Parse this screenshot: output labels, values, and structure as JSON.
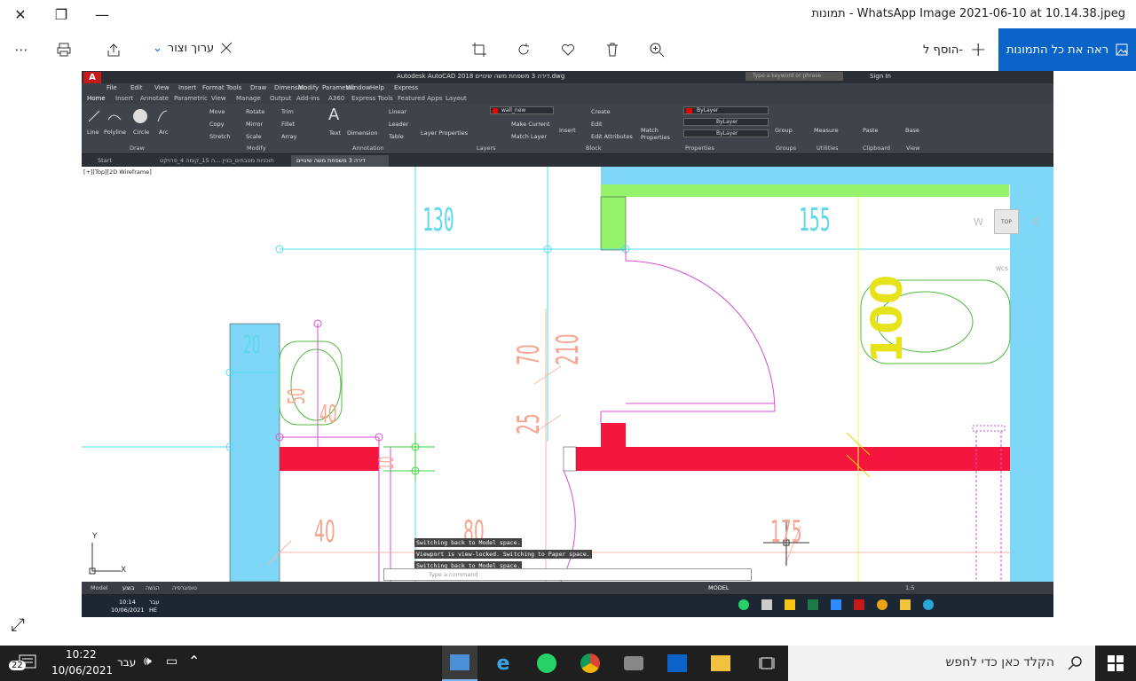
{
  "window": {
    "title": "תמונות - WhatsApp Image 2021-06-10 at 10.14.38.jpeg",
    "close_glyph": "✕",
    "restore_glyph": "❐",
    "minimize_glyph": "—"
  },
  "toolbar": {
    "view_all_label": "ראה את כל התמונות",
    "add_to_label": "הוסף ל-",
    "edit_create_label": "ערוך וצור",
    "more_glyph": "⋯"
  },
  "autocad": {
    "app_title": "Autodesk AutoCAD 2018   דירה 3 משפחת משה שינויים.dwg",
    "search_placeholder": "Type a keyword or phrase",
    "sign_in": "Sign In",
    "menu": [
      "File",
      "Edit",
      "View",
      "Insert",
      "Format",
      "Tools",
      "Draw",
      "Dimension",
      "Modify",
      "Parametric",
      "Window",
      "Help",
      "Express"
    ],
    "ribbon_tabs": [
      "Home",
      "Insert",
      "Annotate",
      "Parametric",
      "View",
      "Manage",
      "Output",
      "Add-ins",
      "A360",
      "Express Tools",
      "Featured Apps",
      "Layout"
    ],
    "draw_tools": [
      "Line",
      "Polyline",
      "Circle",
      "Arc"
    ],
    "modify_tools": [
      "Move",
      "Rotate",
      "Trim",
      "Copy",
      "Mirror",
      "Fillet",
      "Stretch",
      "Scale",
      "Array"
    ],
    "annotation_tools": [
      "Text",
      "Dimension",
      "Linear",
      "Leader",
      "Table"
    ],
    "layer_tools": [
      "Layer Properties",
      "Make Current",
      "Match Layer"
    ],
    "layer_name": "wall_new",
    "block_tools": [
      "Insert",
      "Create",
      "Edit",
      "Edit Attributes"
    ],
    "properties": [
      "Match Properties",
      "ByLayer",
      "ByLayer",
      "ByLayer"
    ],
    "other_tools": [
      "Group",
      "Measure",
      "Paste",
      "Base"
    ],
    "panel_labels": [
      "Draw",
      "Modify",
      "Annotation",
      "Layers",
      "Block",
      "Properties",
      "Groups",
      "Utilities",
      "Clipboard",
      "View"
    ],
    "file_tabs": [
      "Start",
      "תוכניות מטבחים_בניין ...ה 15_קומה 4_פרויקט",
      "דירה 3 משפחת משה שינויים"
    ],
    "viewport_label": "[+][Top][2D Wireframe]",
    "viewcube": {
      "top": "TOP",
      "west": "W",
      "east": "E",
      "wcs": "WCS"
    },
    "dims": [
      "130",
      "155",
      "100",
      "20",
      "50",
      "40",
      "70",
      "210",
      "25",
      "40",
      "80",
      "175",
      "10"
    ],
    "command_lines": [
      "Switching back to Model space.",
      "Viewport is view-locked. Switching to Paper space.",
      "Switching back to Model space."
    ],
    "command_placeholder": "Type a command",
    "layout_tabs": [
      "Model",
      "בוצע",
      "הגשה",
      "טופוגרפיה"
    ],
    "model_label": "MODEL",
    "scale_label": "1:5",
    "axis": {
      "x": "X",
      "y": "Y"
    },
    "inner_time": "10:14",
    "inner_date": "10/06/2021",
    "inner_lang": "עבר",
    "inner_lang2": "HE"
  },
  "taskbar": {
    "search_placeholder": "הקלד כאן כדי לחפש",
    "time": "10:22",
    "date": "10/06/2021",
    "lang": "עבר",
    "notification_count": "22"
  }
}
